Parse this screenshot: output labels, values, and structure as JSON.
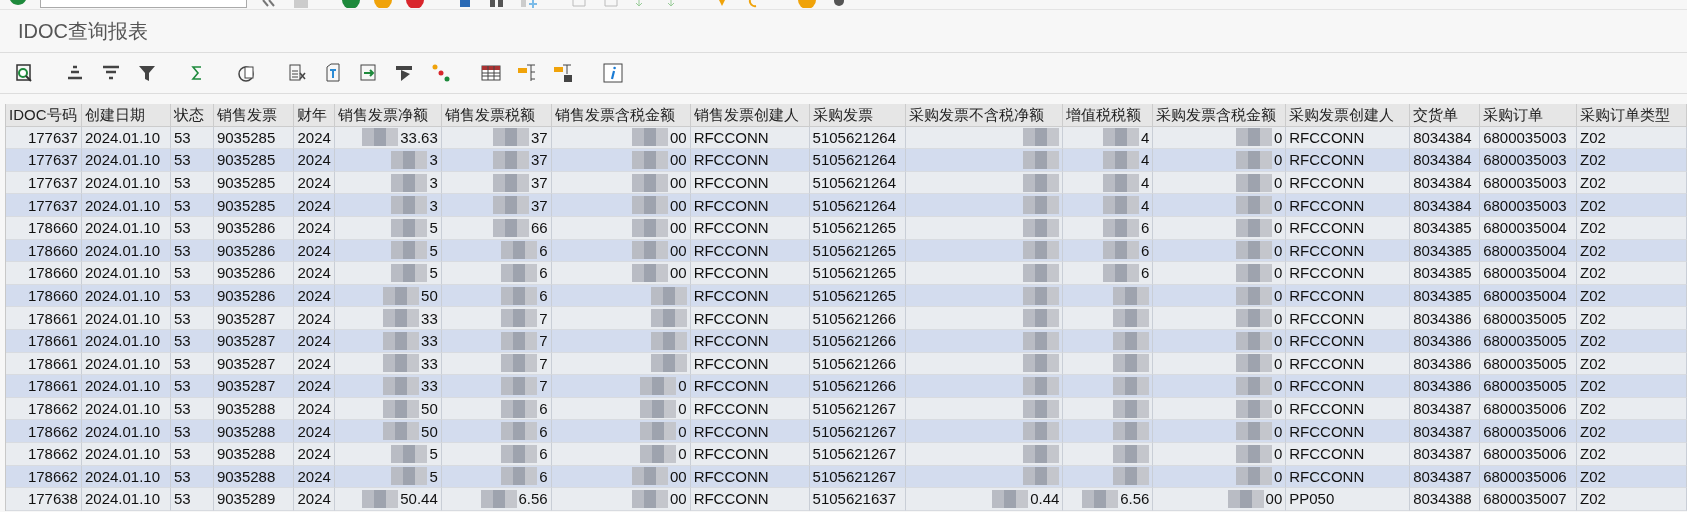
{
  "window": {
    "title": "IDOC查询报表"
  },
  "table": {
    "columns": [
      {
        "label": "IDOC号码"
      },
      {
        "label": "创建日期"
      },
      {
        "label": "状态"
      },
      {
        "label": "销售发票"
      },
      {
        "label": "财年"
      },
      {
        "label": "销售发票净额"
      },
      {
        "label": "销售发票税额"
      },
      {
        "label": "销售发票含税金额"
      },
      {
        "label": "销售发票创建人"
      },
      {
        "label": "采购发票"
      },
      {
        "label": "采购发票不含税净额"
      },
      {
        "label": "增值税税额"
      },
      {
        "label": "采购发票含税金额"
      },
      {
        "label": "采购发票创建人"
      },
      {
        "label": "交货单"
      },
      {
        "label": "采购订单"
      },
      {
        "label": "采购订单类型"
      }
    ],
    "rows": [
      [
        "177637",
        "2024.01.10",
        "53",
        "9035285",
        "2024",
        "33.63",
        "37",
        "00",
        "RFCCONN",
        "5105621264",
        "",
        "4",
        "0",
        "RFCCONN",
        "8034384",
        "6800035003",
        "Z02"
      ],
      [
        "177637",
        "2024.01.10",
        "53",
        "9035285",
        "2024",
        "3",
        "37",
        "00",
        "RFCCONN",
        "5105621264",
        "",
        "4",
        "0",
        "RFCCONN",
        "8034384",
        "6800035003",
        "Z02"
      ],
      [
        "177637",
        "2024.01.10",
        "53",
        "9035285",
        "2024",
        "3",
        "37",
        "00",
        "RFCCONN",
        "5105621264",
        "",
        "4",
        "0",
        "RFCCONN",
        "8034384",
        "6800035003",
        "Z02"
      ],
      [
        "177637",
        "2024.01.10",
        "53",
        "9035285",
        "2024",
        "3",
        "37",
        "00",
        "RFCCONN",
        "5105621264",
        "",
        "4",
        "0",
        "RFCCONN",
        "8034384",
        "6800035003",
        "Z02"
      ],
      [
        "178660",
        "2024.01.10",
        "53",
        "9035286",
        "2024",
        "5",
        "66",
        "00",
        "RFCCONN",
        "5105621265",
        "",
        "6",
        "0",
        "RFCCONN",
        "8034385",
        "6800035004",
        "Z02"
      ],
      [
        "178660",
        "2024.01.10",
        "53",
        "9035286",
        "2024",
        "5",
        "6",
        "00",
        "RFCCONN",
        "5105621265",
        "",
        "6",
        "0",
        "RFCCONN",
        "8034385",
        "6800035004",
        "Z02"
      ],
      [
        "178660",
        "2024.01.10",
        "53",
        "9035286",
        "2024",
        "5",
        "6",
        "00",
        "RFCCONN",
        "5105621265",
        "",
        "6",
        "0",
        "RFCCONN",
        "8034385",
        "6800035004",
        "Z02"
      ],
      [
        "178660",
        "2024.01.10",
        "53",
        "9035286",
        "2024",
        "50",
        "6",
        "",
        "RFCCONN",
        "5105621265",
        "",
        "",
        "0",
        "RFCCONN",
        "8034385",
        "6800035004",
        "Z02"
      ],
      [
        "178661",
        "2024.01.10",
        "53",
        "9035287",
        "2024",
        "33",
        "7",
        "",
        "RFCCONN",
        "5105621266",
        "",
        "",
        "0",
        "RFCCONN",
        "8034386",
        "6800035005",
        "Z02"
      ],
      [
        "178661",
        "2024.01.10",
        "53",
        "9035287",
        "2024",
        "33",
        "7",
        "",
        "RFCCONN",
        "5105621266",
        "",
        "",
        "0",
        "RFCCONN",
        "8034386",
        "6800035005",
        "Z02"
      ],
      [
        "178661",
        "2024.01.10",
        "53",
        "9035287",
        "2024",
        "33",
        "7",
        "",
        "RFCCONN",
        "5105621266",
        "",
        "",
        "0",
        "RFCCONN",
        "8034386",
        "6800035005",
        "Z02"
      ],
      [
        "178661",
        "2024.01.10",
        "53",
        "9035287",
        "2024",
        "33",
        "7",
        "0",
        "RFCCONN",
        "5105621266",
        "",
        "",
        "0",
        "RFCCONN",
        "8034386",
        "6800035005",
        "Z02"
      ],
      [
        "178662",
        "2024.01.10",
        "53",
        "9035288",
        "2024",
        "50",
        "6",
        "0",
        "RFCCONN",
        "5105621267",
        "",
        "",
        "0",
        "RFCCONN",
        "8034387",
        "6800035006",
        "Z02"
      ],
      [
        "178662",
        "2024.01.10",
        "53",
        "9035288",
        "2024",
        "50",
        "6",
        "0",
        "RFCCONN",
        "5105621267",
        "",
        "",
        "0",
        "RFCCONN",
        "8034387",
        "6800035006",
        "Z02"
      ],
      [
        "178662",
        "2024.01.10",
        "53",
        "9035288",
        "2024",
        "5",
        "6",
        "0",
        "RFCCONN",
        "5105621267",
        "",
        "",
        "0",
        "RFCCONN",
        "8034387",
        "6800035006",
        "Z02"
      ],
      [
        "178662",
        "2024.01.10",
        "53",
        "9035288",
        "2024",
        "5",
        "6",
        "00",
        "RFCCONN",
        "5105621267",
        "",
        "",
        "0",
        "RFCCONN",
        "8034387",
        "6800035006",
        "Z02"
      ],
      [
        "177638",
        "2024.01.10",
        "53",
        "9035289",
        "2024",
        "50.44",
        "6.56",
        "00",
        "RFCCONN",
        "5105621637",
        "0.44",
        "6.56",
        "00",
        "PP050",
        "8034388",
        "6800035007",
        "Z02"
      ]
    ]
  }
}
